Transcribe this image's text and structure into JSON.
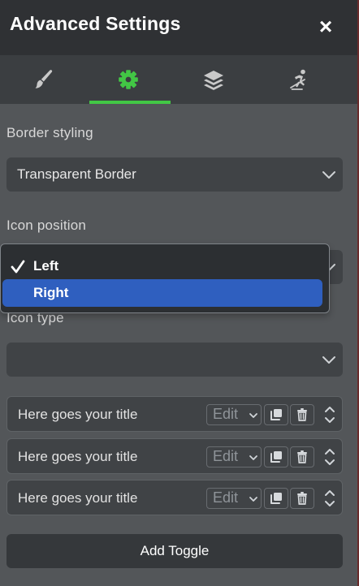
{
  "header": {
    "title": "Advanced Settings",
    "close_symbol": "×"
  },
  "tabs": [
    {
      "name": "style",
      "icon": "paintbrush-icon",
      "active": false
    },
    {
      "name": "settings",
      "icon": "gear-icon",
      "active": true
    },
    {
      "name": "layers",
      "icon": "layers-icon",
      "active": false
    },
    {
      "name": "motion",
      "icon": "motion-icon",
      "active": false
    }
  ],
  "border_styling": {
    "label": "Border styling",
    "value": "Transparent Border"
  },
  "icon_position": {
    "label": "Icon position",
    "options": [
      "Left",
      "Right"
    ],
    "selected": "Left",
    "highlighted": "Right"
  },
  "icon_type": {
    "label": "Icon type",
    "value": ""
  },
  "toggles": [
    {
      "title": "Here goes your title",
      "edit_label": "Edit"
    },
    {
      "title": "Here goes your title",
      "edit_label": "Edit"
    },
    {
      "title": "Here goes your title",
      "edit_label": "Edit"
    }
  ],
  "add_toggle": {
    "label": "Add Toggle"
  },
  "colors": {
    "accent_green": "#42c745",
    "selection_blue": "#2f5fbf"
  }
}
